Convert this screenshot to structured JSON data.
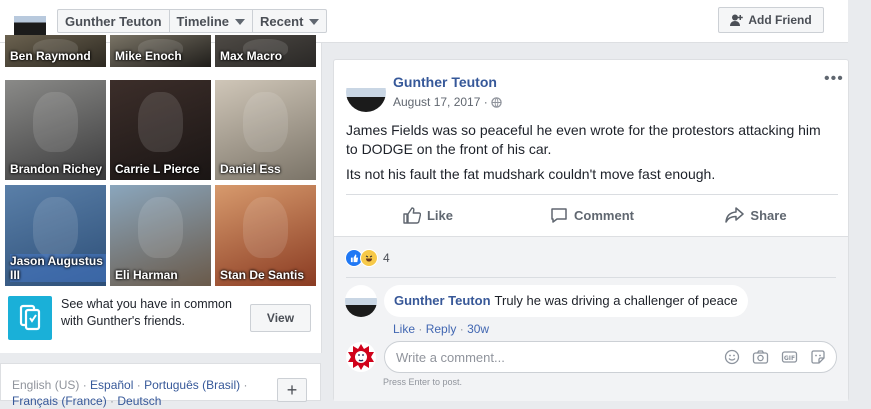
{
  "topbar": {
    "name_tab": "Gunther Teuton",
    "timeline_tab": "Timeline",
    "recent_tab": "Recent",
    "add_friend": "Add Friend"
  },
  "friends": {
    "tiles": [
      {
        "name": "Ben Raymond",
        "colors": [
          "#6b6250",
          "#2c2820"
        ]
      },
      {
        "name": "Mike Enoch",
        "colors": [
          "#7a7466",
          "#1f1d1a"
        ]
      },
      {
        "name": "Max Macro",
        "colors": [
          "#4e4a45",
          "#2a2826"
        ]
      },
      {
        "name": "Brandon Richey",
        "colors": [
          "#8a8a88",
          "#3b3b3c"
        ]
      },
      {
        "name": "Carrie L Pierce",
        "colors": [
          "#3c2e2a",
          "#1a1514"
        ]
      },
      {
        "name": "Daniel Ess",
        "colors": [
          "#cfc6b8",
          "#7b7468"
        ]
      },
      {
        "name": "Jason Augustus III",
        "colors": [
          "#5a7fa8",
          "#2d4f78"
        ]
      },
      {
        "name": "Eli Harman",
        "colors": [
          "#8aa6bd",
          "#6a5a4a"
        ]
      },
      {
        "name": "Stan De Santis",
        "colors": [
          "#d79a6d",
          "#8a3b22"
        ]
      }
    ],
    "common_text": "See what you have in common with Gunther's friends.",
    "view_button": "View"
  },
  "languages": {
    "current": "English (US)",
    "links": [
      "Español",
      "Português (Brasil)",
      "Français (France)",
      "Deutsch"
    ],
    "separator": " · "
  },
  "post": {
    "author": "Gunther Teuton",
    "date": "August 17, 2017",
    "date_sep": "·",
    "paragraph1": "James Fields was so peaceful he even wrote for the protestors attacking him to DODGE on the front of his car.",
    "paragraph2": "Its not his fault the fat mudshark couldn't move fast enough.",
    "actions": {
      "like": "Like",
      "comment": "Comment",
      "share": "Share"
    },
    "reaction_count": "4"
  },
  "comment": {
    "author": "Gunther Teuton",
    "text": "Truly he was driving a challenger of peace",
    "like": "Like",
    "reply": "Reply",
    "age": "30w",
    "dot": "·"
  },
  "composer": {
    "placeholder": "Write a comment...",
    "hint": "Press Enter to post."
  }
}
